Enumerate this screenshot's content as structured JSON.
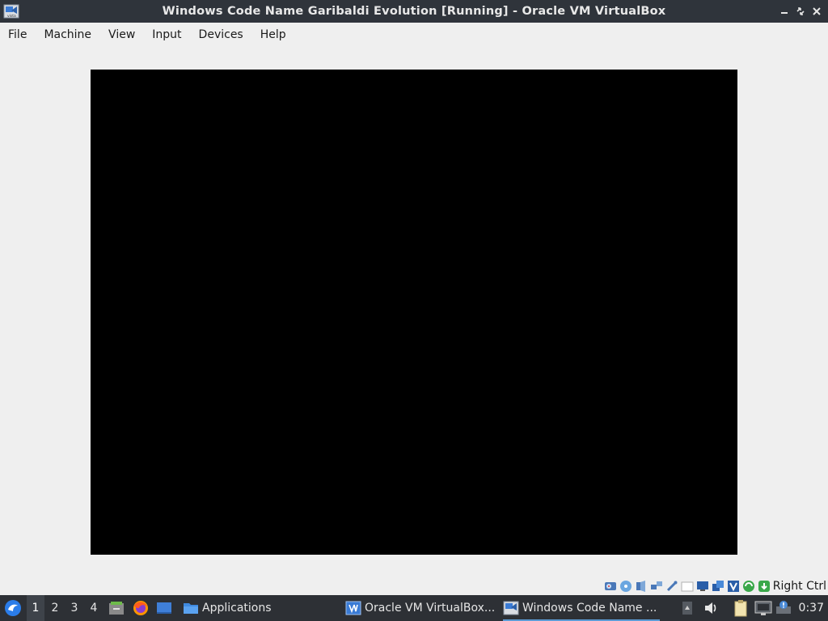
{
  "window": {
    "title": "Windows Code Name Garibaldi Evolution [Running] - Oracle VM VirtualBox",
    "app_icon": "virtualbox-vista-icon",
    "controls": {
      "minimize": "minimize-icon",
      "restore": "restore-icon",
      "close": "close-icon"
    }
  },
  "menubar": {
    "items": [
      "File",
      "Machine",
      "View",
      "Input",
      "Devices",
      "Help"
    ]
  },
  "vm_display": {
    "state": "blank",
    "background": "#000000"
  },
  "statusbar": {
    "icons": [
      "hard-disk-icon",
      "optical-drive-icon",
      "audio-icon",
      "network-icon",
      "usb-icon",
      "shared-folders-icon",
      "display-icon",
      "video-capture-icon",
      "virtualization-icon",
      "mouse-integration-icon",
      "keyboard-capture-icon"
    ],
    "host_key": "Right Ctrl"
  },
  "taskbar": {
    "start_icon": "lxqt-start-icon",
    "workspaces": [
      "1",
      "2",
      "3",
      "4"
    ],
    "active_workspace": "1",
    "quicklaunch": [
      "file-manager-icon",
      "firefox-icon",
      "desktop-icon"
    ],
    "applications_label": "Applications",
    "tasks": [
      {
        "label": "Oracle VM VirtualBox...",
        "icon": "virtualbox-icon",
        "active": false
      },
      {
        "label": "Windows Code Name ...",
        "icon": "vm-vista-icon",
        "active": true
      }
    ],
    "tray": [
      "scroll-up-icon",
      "volume-icon",
      "clipboard-icon",
      "network-tray-icon",
      "update-notifier-icon"
    ],
    "clock": "0:37"
  },
  "colors": {
    "titlebar": "#2f343b",
    "taskbar": "#2d3035",
    "accent": "#5b9bd5"
  }
}
